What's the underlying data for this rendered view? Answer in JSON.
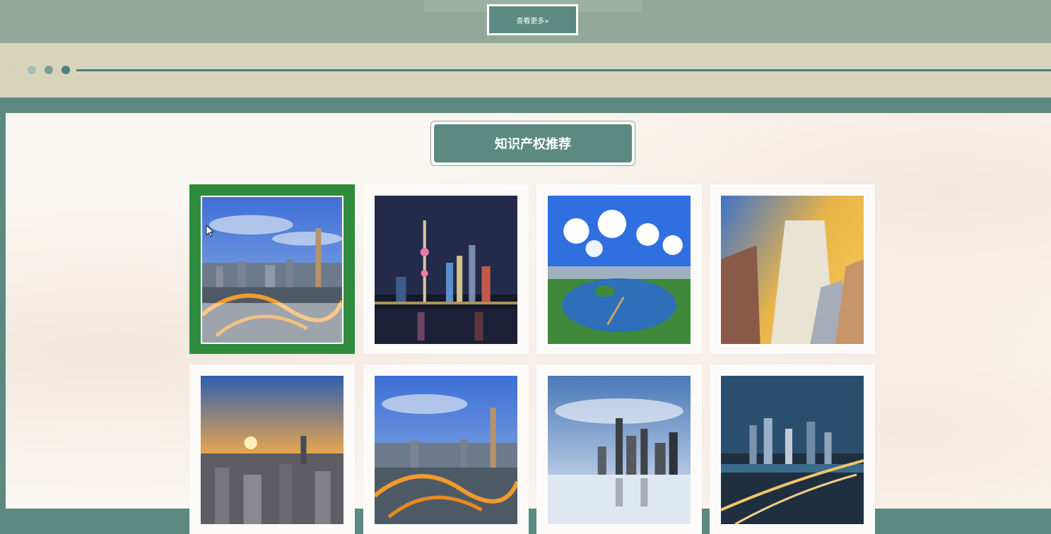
{
  "header": {
    "more_button_label": "查看更多»"
  },
  "section": {
    "title": "知识产权推荐"
  },
  "timeline": {
    "dot_colors": [
      "#d3d2c2",
      "#a7bfb5",
      "#7a9f96",
      "#4d8078"
    ]
  },
  "colors": {
    "accent": "#5c8a80",
    "selected": "#2e8b3e",
    "timeline": "#d8d4bc"
  },
  "cards": [
    {
      "scene": "city-skyline-day",
      "selected": true
    },
    {
      "scene": "night-skyline-tower"
    },
    {
      "scene": "lake-park-clouds"
    },
    {
      "scene": "skyscraper-low-angle"
    },
    {
      "scene": "sunset-city"
    },
    {
      "scene": "city-skyline-day"
    },
    {
      "scene": "waterfront-skyline"
    },
    {
      "scene": "night-city-interchange"
    }
  ]
}
